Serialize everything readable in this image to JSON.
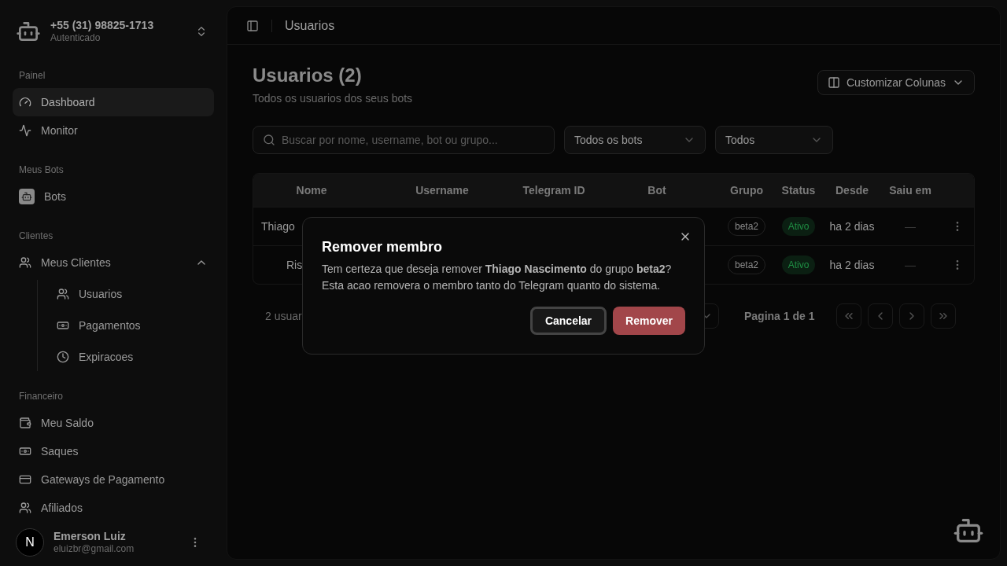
{
  "account": {
    "phone": "+55 (31) 98825-1713",
    "status": "Autenticado"
  },
  "sidebar": {
    "sections": [
      {
        "title": "Painel",
        "items": [
          {
            "label": "Dashboard",
            "selected": true
          },
          {
            "label": "Monitor",
            "selected": false
          }
        ]
      },
      {
        "title": "Meus Bots",
        "items": [
          {
            "label": "Bots",
            "selected": false
          }
        ]
      },
      {
        "title": "Clientes",
        "items": [
          {
            "label": "Meus Clientes",
            "selected": false,
            "expanded": true,
            "children": [
              {
                "label": "Usuarios",
                "selected": false
              },
              {
                "label": "Pagamentos",
                "selected": false
              },
              {
                "label": "Expiracoes",
                "selected": false
              }
            ]
          }
        ]
      },
      {
        "title": "Financeiro",
        "items": [
          {
            "label": "Meu Saldo",
            "selected": false
          },
          {
            "label": "Saques",
            "selected": false
          },
          {
            "label": "Gateways de Pagamento",
            "selected": false
          },
          {
            "label": "Afiliados",
            "selected": false
          }
        ]
      }
    ]
  },
  "user": {
    "initial": "N",
    "name": "Emerson Luiz",
    "email": "eluizbr@gmail.com"
  },
  "header": {
    "title": "Usuarios"
  },
  "page": {
    "title": "Usuarios (2)",
    "subtitle": "Todos os usuarios dos seus bots",
    "columns_button": "Customizar Colunas"
  },
  "filters": {
    "search_placeholder": "Buscar por nome, username, bot ou grupo...",
    "bot_select": "Todos os bots",
    "status_select": "Todos"
  },
  "table": {
    "columns": [
      "Nome",
      "Username",
      "Telegram ID",
      "Bot",
      "Grupo",
      "Status",
      "Desde",
      "Saiu em"
    ],
    "rows": [
      {
        "name": "Thiago",
        "group": "beta2",
        "status": "Ativo",
        "since": "ha 2 dias",
        "left": "—"
      },
      {
        "name": "Ris",
        "group": "beta2",
        "status": "Ativo",
        "since": "ha 2 dias",
        "left": "—"
      }
    ]
  },
  "footer": {
    "count": "2 usuar",
    "page": "Pagina 1 de 1"
  },
  "dialog": {
    "title": "Remover membro",
    "message": "Tem certeza que deseja remover **Thiago Nascimento** do grupo **beta2**?",
    "message_2": "Esta acao removera o membro tanto do Telegram quanto do sistema.",
    "cancel": "Cancelar",
    "confirm": "Remover"
  }
}
